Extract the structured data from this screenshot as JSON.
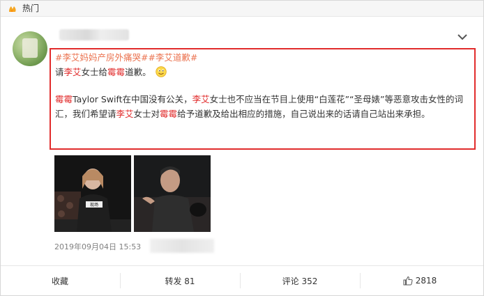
{
  "hot_bar": {
    "label": "热门"
  },
  "post": {
    "topics": [
      "#李艾妈妈产房外痛哭#",
      "#李艾道歉#"
    ],
    "line1": {
      "pre": "请",
      "hl1": "李艾",
      "mid": "女士给",
      "hl2": "霉霉",
      "post": "道歉。"
    },
    "para2": [
      {
        "text": "霉霉",
        "hl": true
      },
      {
        "text": "Taylor Swift在中国没有公关，",
        "hl": false
      },
      {
        "text": "李艾",
        "hl": true
      },
      {
        "text": "女士也不应当在节目上使用“白莲花”“圣母婊”等恶意攻击女性的词汇，我们希望请",
        "hl": false
      },
      {
        "text": "李艾",
        "hl": true
      },
      {
        "text": "女士对",
        "hl": false
      },
      {
        "text": "霉霉",
        "hl": true
      },
      {
        "text": "给予道歉及给出相应的措施，自己说出来的话请自己站出来承担。",
        "hl": false
      }
    ],
    "timestamp": "2019年09月04日 15:53",
    "photo1_caption": "现场",
    "photo2_caption": ""
  },
  "actions": {
    "favorite": "收藏",
    "repost": "转发 81",
    "comment": "评论 352",
    "like": "2818"
  },
  "colors": {
    "topic": "#eb7350",
    "highlight": "#e12b2b",
    "box_border": "#e12b2b"
  },
  "icons": [
    "hot-icon",
    "chevron-down-icon",
    "smile-emoji-icon",
    "thumbs-up-icon"
  ]
}
